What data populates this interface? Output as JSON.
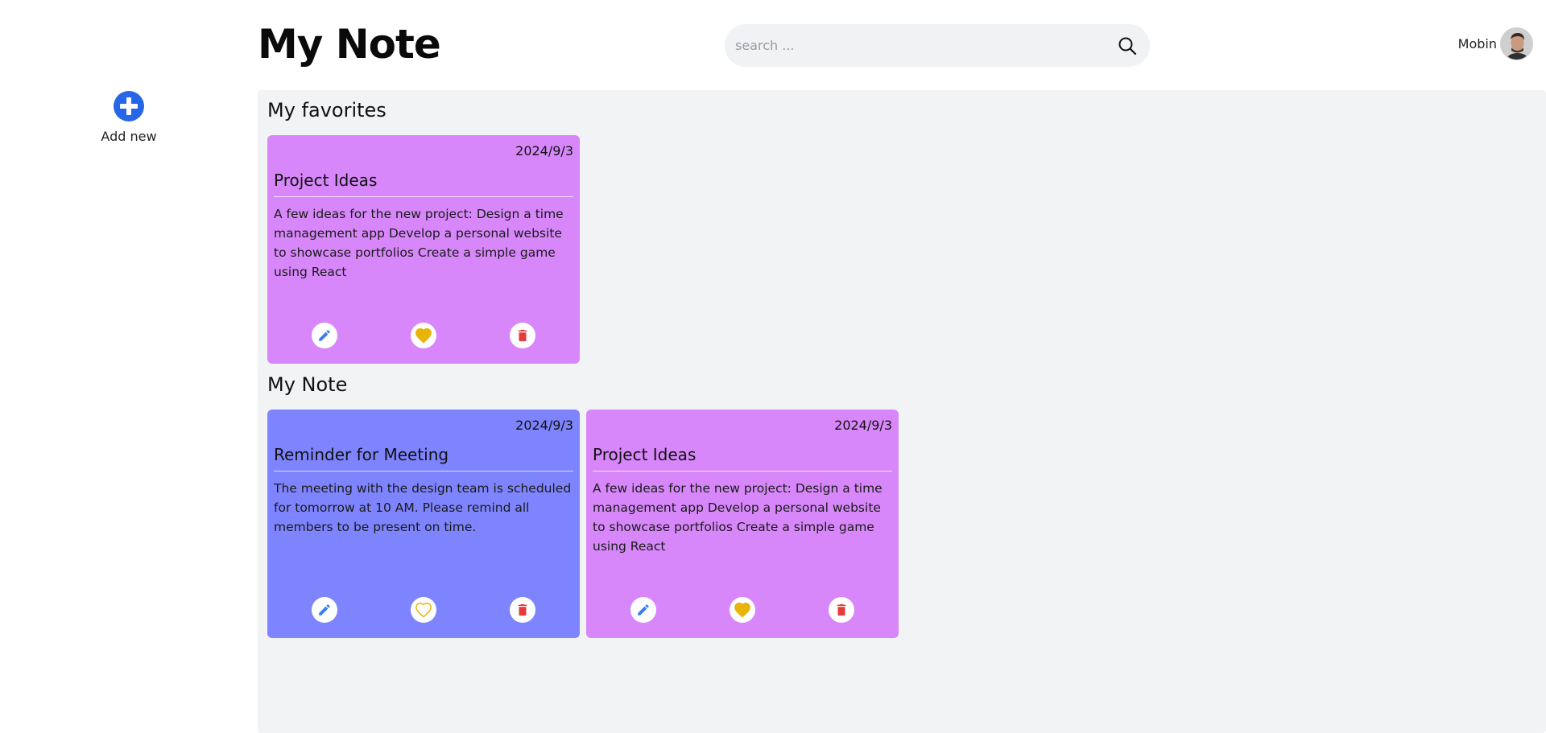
{
  "header": {
    "title": "My Note",
    "search_placeholder": "search ...",
    "user_name": "Mobin"
  },
  "sidebar": {
    "add_label": "Add new"
  },
  "favorites": {
    "title": "My favorites",
    "cards": [
      {
        "date": "2024/9/3",
        "title": "Project Ideas",
        "body": "A few ideas for the new project: Design a time management app Develop a personal website to showcase portfolios Create a simple game using React",
        "color": "#d787f9",
        "favorite": true
      }
    ]
  },
  "notes": {
    "title": "My Note",
    "cards": [
      {
        "date": "2024/9/3",
        "title": "Reminder for Meeting",
        "body": "The meeting with the design team is scheduled for tomorrow at 10 AM. Please remind all members to be present on time.",
        "color": "#7e84fd",
        "favorite": false
      },
      {
        "date": "2024/9/3",
        "title": "Project Ideas",
        "body": "A few ideas for the new project: Design a time management app Develop a personal website to showcase portfolios Create a simple game using React",
        "color": "#d787f9",
        "favorite": true
      }
    ]
  },
  "colors": {
    "accent": "#2667e8",
    "edit": "#3a7de8",
    "favorite": "#e9b307",
    "delete": "#e53b3b",
    "panel": "#f2f3f5"
  }
}
